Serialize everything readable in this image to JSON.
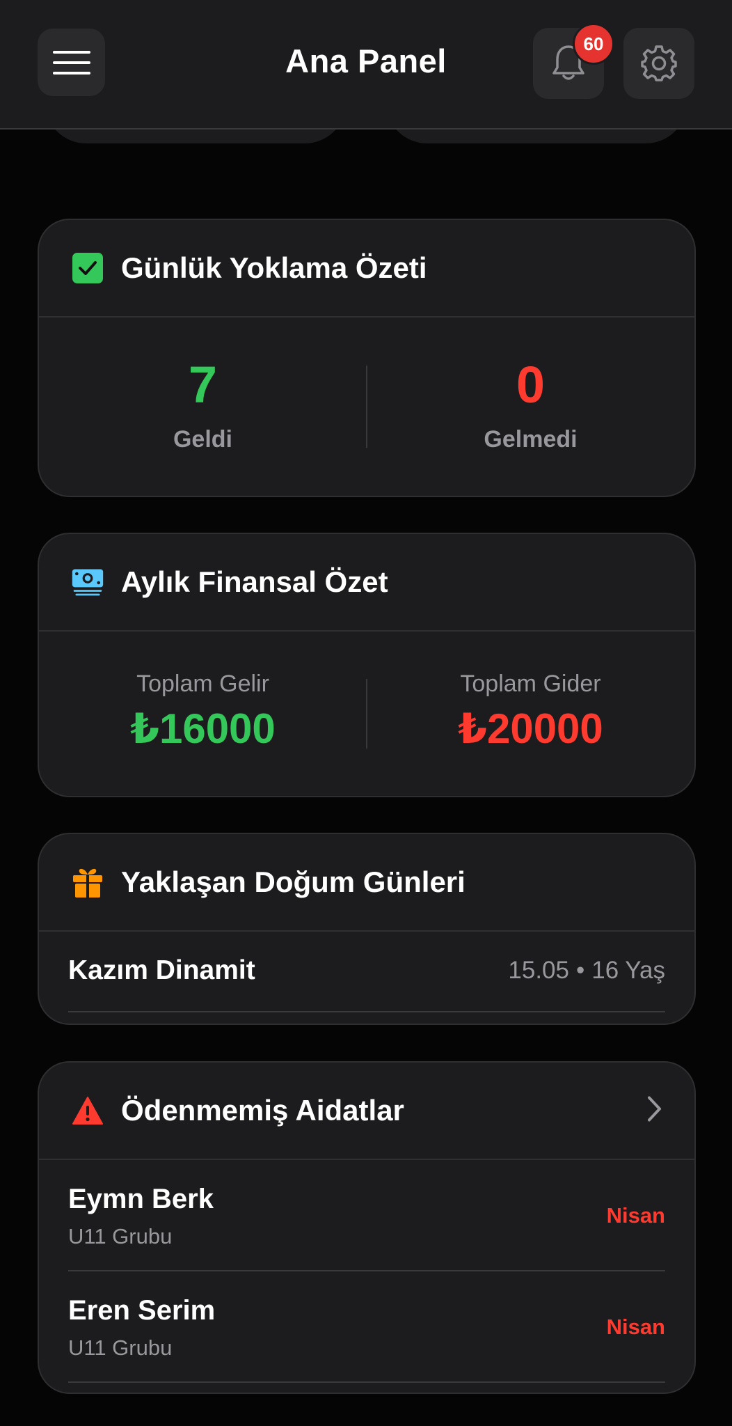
{
  "header": {
    "title": "Ana Panel",
    "notification_count": "60",
    "menu_icon": "menu-icon",
    "bell_icon": "bell-icon",
    "gear_icon": "gear-icon"
  },
  "attendance": {
    "title": "Günlük Yoklama Özeti",
    "icon": "check-square-icon",
    "present_value": "7",
    "present_label": "Geldi",
    "absent_value": "0",
    "absent_label": "Gelmedi"
  },
  "finance": {
    "title": "Aylık Finansal Özet",
    "icon": "banknote-icon",
    "income_label": "Toplam Gelir",
    "income_value": "₺16000",
    "expense_label": "Toplam Gider",
    "expense_value": "₺20000"
  },
  "birthdays": {
    "title": "Yaklaşan Doğum Günleri",
    "icon": "gift-icon",
    "items": [
      {
        "name": "Kazım Dinamit",
        "date": "15.05",
        "separator": "•",
        "age": "16 Yaş"
      }
    ]
  },
  "dues": {
    "title": "Ödenmemiş Aidatlar",
    "icon": "warning-icon",
    "items": [
      {
        "name": "Eymn Berk",
        "group": "U11 Grubu",
        "month": "Nisan"
      },
      {
        "name": "Eren Serim",
        "group": "U11 Grubu",
        "month": "Nisan"
      }
    ]
  },
  "colors": {
    "background": "#050505",
    "card": "#1c1c1e",
    "positive": "#34c759",
    "negative": "#ff3b30",
    "secondary_text": "#98989d",
    "badge": "#e5342f",
    "gift": "#ff9500",
    "finance_icon": "#5ac8fa"
  }
}
